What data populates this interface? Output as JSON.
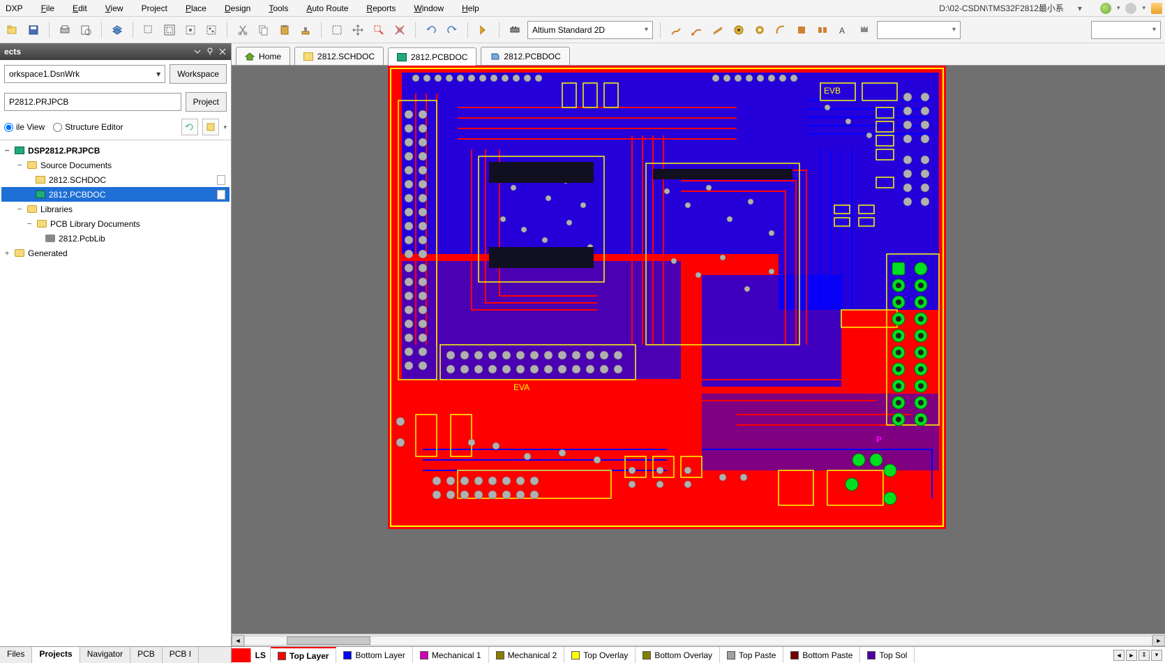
{
  "menu": {
    "items": [
      "DXP",
      "File",
      "Edit",
      "View",
      "Project",
      "Place",
      "Design",
      "Tools",
      "Auto Route",
      "Reports",
      "Window",
      "Help"
    ],
    "path": "D:\\02-CSDN\\TMS32F2812最小系"
  },
  "toolbar": {
    "view_mode": "Altium Standard 2D"
  },
  "projects_panel": {
    "title": "ects",
    "workspace": "orkspace1.DsnWrk",
    "workspace_btn": "Workspace",
    "project": "P2812.PRJPCB",
    "project_btn": "Project",
    "radio_file": "ile View",
    "radio_struct": "Structure Editor",
    "tree": {
      "root": "DSP2812.PRJPCB",
      "source_docs": "Source Documents",
      "sch": "2812.SCHDOC",
      "pcb": "2812.PCBDOC",
      "libraries": "Libraries",
      "pcb_lib_docs": "PCB Library Documents",
      "pcblib": "2812.PcbLib",
      "generated": "Generated"
    }
  },
  "left_tabs": [
    "Files",
    "Projects",
    "Navigator",
    "PCB",
    "PCB I"
  ],
  "doc_tabs": [
    {
      "label": "Home",
      "icon": "home"
    },
    {
      "label": "2812.SCHDOC",
      "icon": "sch"
    },
    {
      "label": "2812.PCBDOC",
      "icon": "pcb",
      "active": true
    },
    {
      "label": "2812.PCBDOC",
      "icon": "pcb3d"
    }
  ],
  "layer_tabs": {
    "ls": "LS",
    "items": [
      {
        "label": "Top Layer",
        "color": "#ff0000",
        "active": true
      },
      {
        "label": "Bottom Layer",
        "color": "#0000ff"
      },
      {
        "label": "Mechanical 1",
        "color": "#d100b4"
      },
      {
        "label": "Mechanical 2",
        "color": "#8a7a00"
      },
      {
        "label": "Top Overlay",
        "color": "#ffff00"
      },
      {
        "label": "Bottom Overlay",
        "color": "#808000"
      },
      {
        "label": "Top Paste",
        "color": "#a0a0a0"
      },
      {
        "label": "Bottom Paste",
        "color": "#700000"
      },
      {
        "label": "Top Sol",
        "color": "#5000a0"
      }
    ]
  }
}
